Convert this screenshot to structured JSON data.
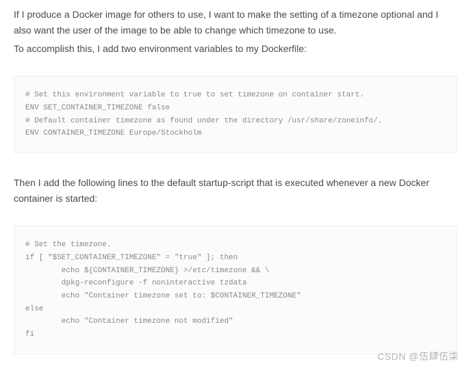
{
  "intro": {
    "p1": "If I produce a Docker image for others to use, I want to make the setting of a timezone optional and I also want the user of the image to be able to change which timezone to use.",
    "p2": "To accomplish this, I add two environment variables to my Dockerfile:"
  },
  "code1": "# Set this environment variable to true to set timezone on container start.\nENV SET_CONTAINER_TIMEZONE false\n# Default container timezone as found under the directory /usr/share/zoneinfo/.\nENV CONTAINER_TIMEZONE Europe/Stockholm",
  "mid": {
    "p1": "Then I add the following lines to the default startup-script that is executed whenever a new Docker container is started:"
  },
  "code2": "# Set the timezone.\nif [ \"$SET_CONTAINER_TIMEZONE\" = \"true\" ]; then\n        echo ${CONTAINER_TIMEZONE} >/etc/timezone && \\\n        dpkg-reconfigure -f noninteractive tzdata\n        echo \"Container timezone set to: $CONTAINER_TIMEZONE\"\nelse\n        echo \"Container timezone not modified\"\nfi",
  "watermark": "CSDN @伍肆伍柒"
}
